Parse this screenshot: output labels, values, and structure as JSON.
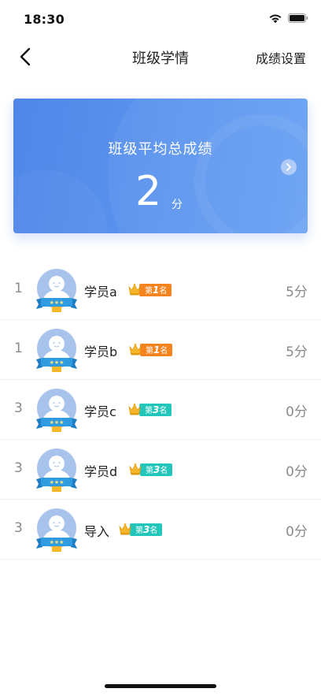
{
  "status_bar": {
    "time": "18:30",
    "wifi_icon": "wifi-icon",
    "battery_icon": "battery-icon"
  },
  "nav": {
    "back_icon": "chevron-left-icon",
    "title": "班级学情",
    "settings_label": "成绩设置"
  },
  "summary": {
    "label": "班级平均总成绩",
    "value": "2",
    "unit": "分",
    "arrow_icon": "chevron-right-icon"
  },
  "students": [
    {
      "rank": "1",
      "name": "学员a",
      "badge_prefix": "第",
      "badge_rank": "1",
      "badge_suffix": "名",
      "badge_color": "#f5841f",
      "score": "5分"
    },
    {
      "rank": "1",
      "name": "学员b",
      "badge_prefix": "第",
      "badge_rank": "1",
      "badge_suffix": "名",
      "badge_color": "#f5841f",
      "score": "5分"
    },
    {
      "rank": "3",
      "name": "学员c",
      "badge_prefix": "第",
      "badge_rank": "3",
      "badge_suffix": "名",
      "badge_color": "#22c6bb",
      "score": "0分"
    },
    {
      "rank": "3",
      "name": "学员d",
      "badge_prefix": "第",
      "badge_rank": "3",
      "badge_suffix": "名",
      "badge_color": "#22c6bb",
      "score": "0分"
    },
    {
      "rank": "3",
      "name": "导入",
      "badge_prefix": "第",
      "badge_rank": "3",
      "badge_suffix": "名",
      "badge_color": "#22c6bb",
      "score": "0分"
    }
  ],
  "colors": {
    "card_start": "#4f86e8",
    "card_end": "#6aa2f4",
    "avatar_bg": "#a9c4ec",
    "ribbon": "#2f9be0",
    "crown": "#f6b72a"
  }
}
